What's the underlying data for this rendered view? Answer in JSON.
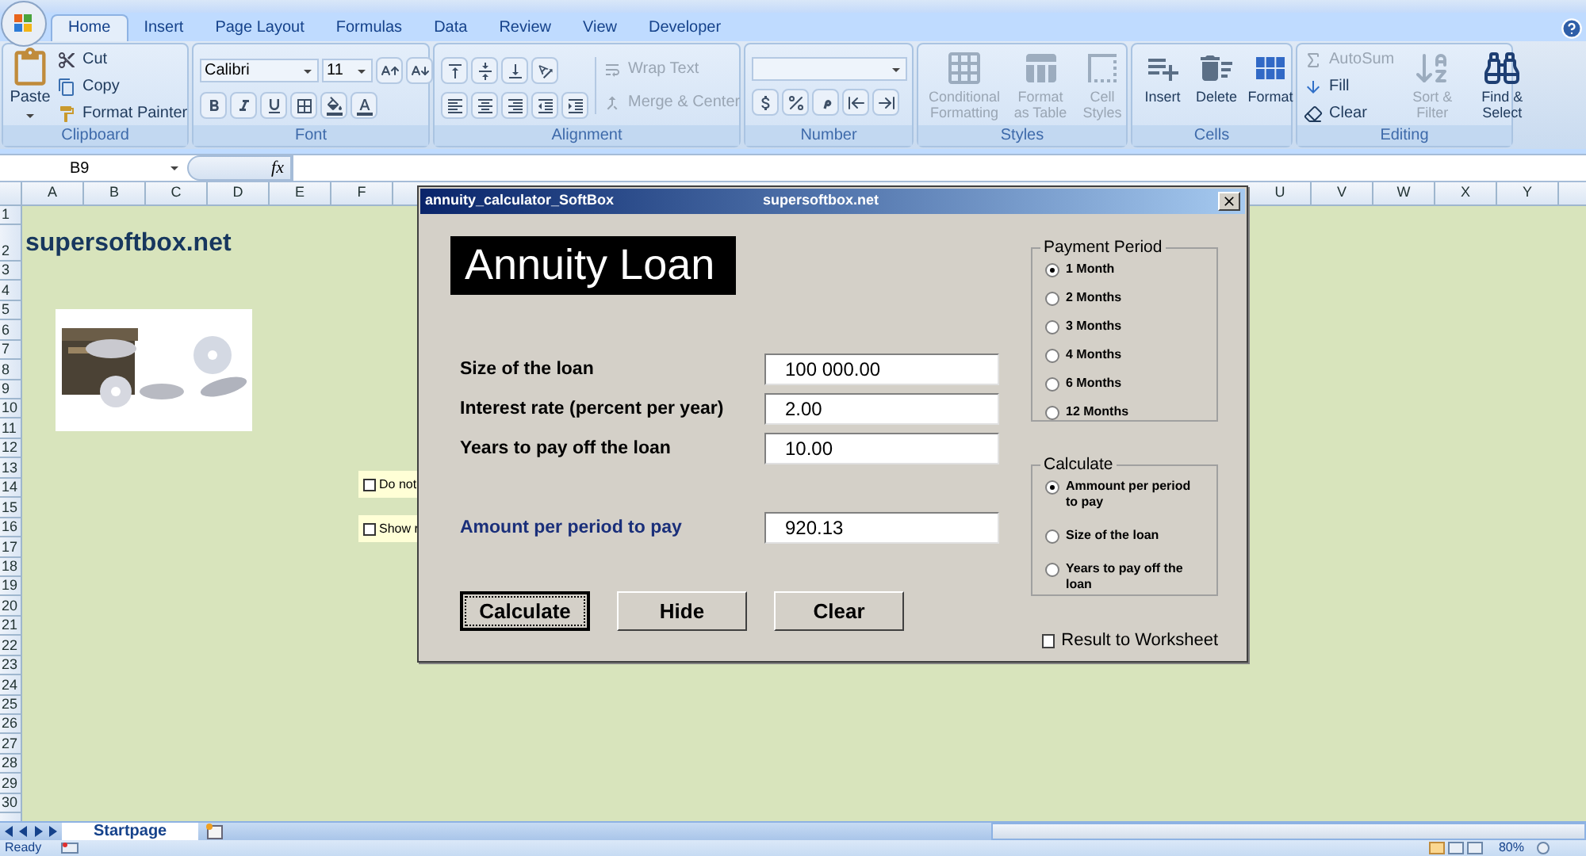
{
  "ribbon": {
    "tabs": [
      {
        "label": "Home",
        "selected": true
      },
      {
        "label": "Insert",
        "selected": false
      },
      {
        "label": "Page Layout",
        "selected": false
      },
      {
        "label": "Formulas",
        "selected": false
      },
      {
        "label": "Data",
        "selected": false
      },
      {
        "label": "Review",
        "selected": false
      },
      {
        "label": "View",
        "selected": false
      },
      {
        "label": "Developer",
        "selected": false
      }
    ],
    "clipboard": {
      "label": "Clipboard",
      "paste": "Paste",
      "items": [
        "Cut",
        "Copy",
        "Format Painter"
      ]
    },
    "font": {
      "label": "Font",
      "font_name": "Calibri",
      "font_size": "11"
    },
    "alignment": {
      "label": "Alignment",
      "items": [
        {
          "label": "Wrap Text",
          "disabled": true
        },
        {
          "label": "Merge & Center",
          "disabled": true
        }
      ]
    },
    "number": {
      "label": "Number"
    },
    "styles": {
      "label": "Styles",
      "items": [
        {
          "label": "Conditional Formatting",
          "disabled": true
        },
        {
          "label": "Format as Table",
          "disabled": true
        },
        {
          "label": "Cell Styles",
          "disabled": true
        }
      ]
    },
    "cells": {
      "label": "Cells",
      "items": [
        "Insert",
        "Delete",
        "Format"
      ]
    },
    "editing": {
      "label": "Editing",
      "items": [
        {
          "label": "AutoSum",
          "disabled": true
        },
        {
          "label": "Fill",
          "disabled": false
        },
        {
          "label": "Clear",
          "disabled": false
        },
        {
          "label": "Sort & Filter",
          "disabled": true
        },
        {
          "label": "Find & Select",
          "disabled": false
        }
      ]
    }
  },
  "formula_bar": {
    "name_box": "B9",
    "function_label": "fx"
  },
  "sheet": {
    "columns_left": [
      "A",
      "B",
      "C",
      "D",
      "E",
      "F"
    ],
    "columns_right": [
      "U",
      "V",
      "W",
      "X",
      "Y"
    ],
    "rows": [
      "1",
      "2",
      "3",
      "4",
      "5",
      "6",
      "7",
      "8",
      "9",
      "10",
      "11",
      "12",
      "13",
      "14",
      "15",
      "16",
      "17",
      "18",
      "19",
      "20",
      "21",
      "22",
      "23",
      "24",
      "25",
      "26",
      "27",
      "28",
      "29",
      "30"
    ],
    "title": "supersoftbox.net",
    "picture": {
      "kind": "picture"
    },
    "checkboxes": [
      {
        "label": "Do not",
        "checked": false
      },
      {
        "label": "Show r",
        "checked": false
      }
    ]
  },
  "sheet_tabs": [
    {
      "label": "Startpage",
      "selected": true
    }
  ],
  "status_bar": {
    "status": "Ready",
    "zoom": "80%"
  },
  "dialog": {
    "title": "annuity_calculator_SoftBox",
    "site": "supersoftbox.net",
    "heading": "Annuity Loan",
    "fields": [
      {
        "label": "Size of the loan",
        "value": "100 000.00",
        "kind": "input"
      },
      {
        "label": "Interest rate (percent per year)",
        "value": "2.00",
        "kind": "input"
      },
      {
        "label": "Years to pay off the loan",
        "value": "10.00",
        "kind": "input"
      },
      {
        "label": "Amount per period to pay",
        "value": "920.13",
        "kind": "result"
      }
    ],
    "buttons": [
      {
        "label": "Calculate",
        "focused": true
      },
      {
        "label": "Hide",
        "focused": false
      },
      {
        "label": "Clear",
        "focused": false
      }
    ],
    "payment_period": {
      "title": "Payment Period",
      "options": [
        {
          "label": "1 Month",
          "selected": true
        },
        {
          "label": "2 Months",
          "selected": false
        },
        {
          "label": "3 Months",
          "selected": false
        },
        {
          "label": "4 Months",
          "selected": false
        },
        {
          "label": "6 Months",
          "selected": false
        },
        {
          "label": "12 Months",
          "selected": false
        }
      ]
    },
    "calculate": {
      "title": "Calculate",
      "options": [
        {
          "label": "Ammount per period to pay",
          "selected": true
        },
        {
          "label": "Size of the loan",
          "selected": false
        },
        {
          "label": "Years to pay off the loan",
          "selected": false
        }
      ]
    },
    "result_to_worksheet": {
      "label": "Result to Worksheet",
      "checked": false
    }
  }
}
